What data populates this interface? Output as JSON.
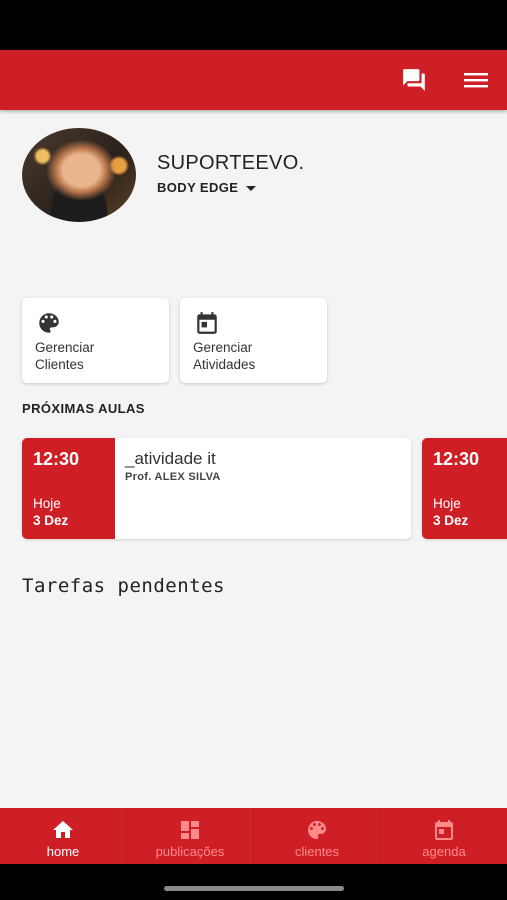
{
  "user": {
    "name": "SUPORTEEVO.",
    "gym": "BODY EDGE"
  },
  "quick_actions": [
    {
      "label_line1": "Gerenciar",
      "label_line2": "Clientes",
      "icon": "palette-icon"
    },
    {
      "label_line1": "Gerenciar",
      "label_line2": "Atividades",
      "icon": "calendar-icon"
    }
  ],
  "upcoming": {
    "title": "PRÓXIMAS AULAS",
    "classes": [
      {
        "time": "12:30",
        "day": "Hoje",
        "date": "3 Dez",
        "activity": "_atividade it",
        "teacher": "Prof.  ALEX SILVA"
      },
      {
        "time": "12:30",
        "day": "Hoje",
        "date": "3 Dez"
      }
    ]
  },
  "pending": {
    "title": "Tarefas pendentes"
  },
  "bottom_nav": [
    {
      "label": "home",
      "icon": "home-icon",
      "active": true
    },
    {
      "label": "publicações",
      "icon": "dashboard-icon",
      "active": false
    },
    {
      "label": "clientes",
      "icon": "palette-icon",
      "active": false
    },
    {
      "label": "agenda",
      "icon": "event-icon",
      "active": false
    }
  ],
  "colors": {
    "primary": "#cf1f26",
    "background": "#f4f4f4",
    "inactive_nav_label": "#ff8a8a"
  }
}
